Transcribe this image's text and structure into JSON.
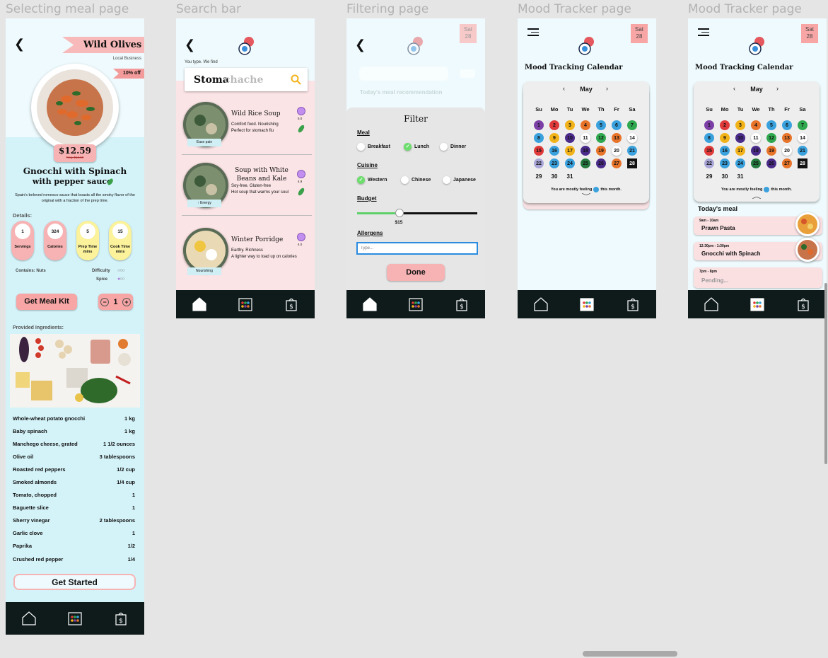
{
  "frames": {
    "f1": "Selecting meal page",
    "f2": "Search bar",
    "f3": "Filtering page",
    "f4": "Mood Tracker page",
    "f5": "Mood Tracker page"
  },
  "meal": {
    "restaurant": "Wild Olives",
    "tag": "Local Business",
    "discount": "10% off",
    "price": "$12.59",
    "old_price": "Reg. $13.99",
    "name": "Gnocchi with Spinach",
    "name2": "with pepper sauce",
    "desc": "Spain's beloved romesco sauce that boasts all the smoky flavor of the original with a fraction of the prep time.",
    "details_label": "Details:",
    "stats": [
      {
        "value": "1",
        "label": "Servings",
        "color": "#f7b3b3"
      },
      {
        "value": "324",
        "label": "Calories",
        "color": "#f7b3b3"
      },
      {
        "value": "5",
        "label": "Prep Time mins",
        "color": "#fbf29b"
      },
      {
        "value": "15",
        "label": "Cook Time mins",
        "color": "#fbf29b"
      }
    ],
    "contains": "Contains: Nuts",
    "difficulty": "Difficulty",
    "spice": "Spice",
    "kit_button": "Get Meal Kit",
    "qty": "1",
    "ingredients_label": "Provided Ingredients:",
    "ingredients": [
      {
        "name": "Whole-wheat potato gnocchi",
        "qty": "1 kg"
      },
      {
        "name": "Baby spinach",
        "qty": "1 kg"
      },
      {
        "name": "Manchego cheese, grated",
        "qty": "1 1/2 ounces"
      },
      {
        "name": "Olive oil",
        "qty": "3 tablespoons"
      },
      {
        "name": "Roasted red peppers",
        "qty": "1/2 cup"
      },
      {
        "name": "Smoked almonds",
        "qty": "1/4 cup"
      },
      {
        "name": "Tomato, chopped",
        "qty": "1"
      },
      {
        "name": "Baguette slice",
        "qty": "1"
      },
      {
        "name": "Sherry vinegar",
        "qty": "2 tablespoons"
      },
      {
        "name": "Garlic clove",
        "qty": "1"
      },
      {
        "name": "Paprika",
        "qty": "1/2"
      },
      {
        "name": "Crushed red pepper",
        "qty": "1/4"
      }
    ],
    "start_button": "Get Started"
  },
  "search": {
    "hint": "You type. We find",
    "typed": "Stoma",
    "suggest": "chache",
    "results": [
      {
        "title": "Wild Rice Soup",
        "desc1": "Comfort food. Nourishing",
        "desc2": "Perfect for stomach flu",
        "rating": "5.0",
        "tag": "Ease pain"
      },
      {
        "title": "Soup with White Beans and Kale",
        "desc1": "Soy-free. Gluten-free",
        "desc2": "Hot soup that warms your soul",
        "rating": "4.9",
        "tag": "↑ Energy"
      },
      {
        "title": "Winter Porridge",
        "desc1": "Earthy. Richness",
        "desc2": "A lighter way to load up on calories",
        "rating": "4.0",
        "tag": "Nourishing"
      }
    ]
  },
  "filter": {
    "date_day": "Sat",
    "date_num": "28",
    "bg_text": "Today's meal recommendation",
    "title": "Filter",
    "meal_label": "Meal",
    "meals": [
      "Breakfast",
      "Lunch",
      "Dinner"
    ],
    "cuisine_label": "Cuisine",
    "cuisines": [
      "Western",
      "Chinese",
      "Japanese"
    ],
    "budget_label": "Budget",
    "budget_value": "$15",
    "budget_fraction": 0.35,
    "allergens_label": "Allergens",
    "allergens_placeholder": "Type...",
    "done": "Done"
  },
  "mood": {
    "title": "Mood Tracking Calendar",
    "month": "May",
    "weekdays": [
      "Su",
      "Mo",
      "Tu",
      "We",
      "Th",
      "Fr",
      "Sa"
    ],
    "feeling_pre": "You are mostly feeling",
    "feeling_post": "this month.",
    "today_label": "Today's meal",
    "meals": [
      {
        "time": "9am - 10am",
        "name": "Prawn Pasta"
      },
      {
        "time": "12:30pm - 1:30pm",
        "name": "Gnocchi with Spinach"
      },
      {
        "time": "7pm - 8pm",
        "name": "Pending..."
      }
    ],
    "colors": {
      "purple": "#7b3fa6",
      "red": "#e03a3a",
      "yellow": "#f2b31a",
      "orange": "#e8742a",
      "blue": "#3aa1dd",
      "green": "#2fa84f",
      "white": "#f4f4f4",
      "darkpurple": "#4a2b8a",
      "black": "#111111",
      "lightpurple": "#a9a6d8",
      "darkgreen": "#247a3f"
    }
  },
  "icons": {
    "back": "chevron-left-icon",
    "menu": "menu-icon",
    "search": "search-icon",
    "home": "home-icon",
    "calendar": "calendar-icon",
    "bag": "bag-icon"
  }
}
